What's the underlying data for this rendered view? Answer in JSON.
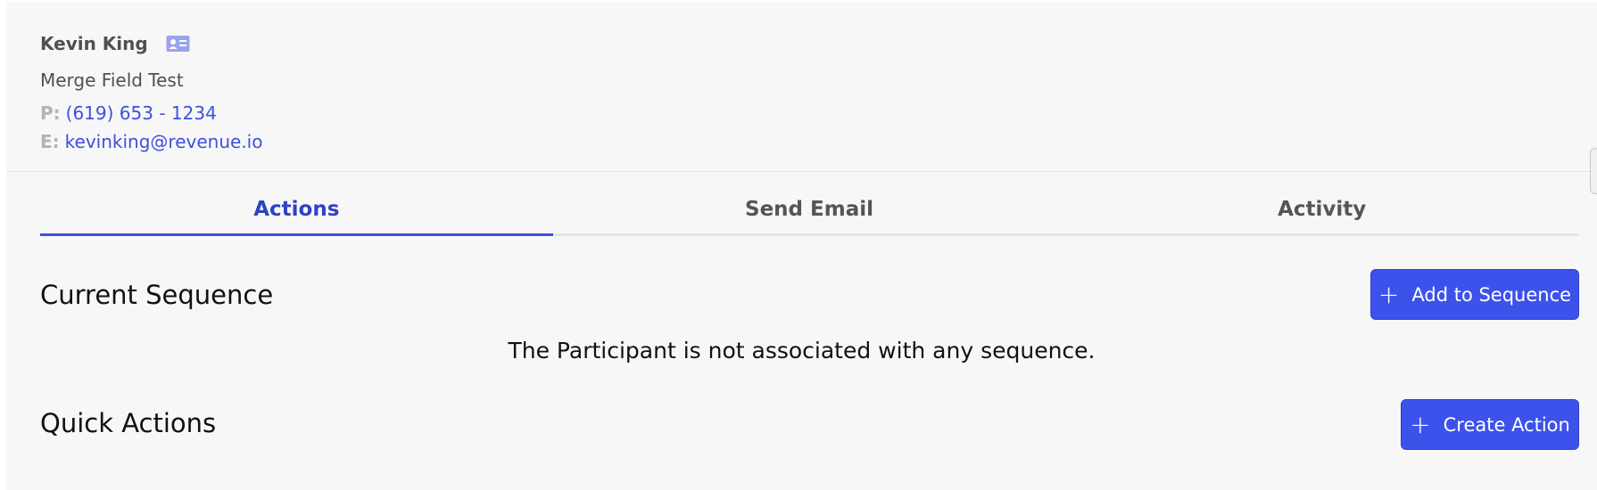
{
  "contact": {
    "name": "Kevin King",
    "company": "Merge Field Test",
    "phone_label": "P:",
    "phone": "(619) 653 - 1234",
    "email_label": "E:",
    "email": "kevinking@revenue.io",
    "card_icon": "contact-card-icon"
  },
  "tabs": [
    {
      "label": "Actions",
      "active": true
    },
    {
      "label": "Send Email",
      "active": false
    },
    {
      "label": "Activity",
      "active": false
    }
  ],
  "current_sequence": {
    "title": "Current Sequence",
    "button_label": "Add to Sequence",
    "empty_message": "The Participant is not associated with any sequence."
  },
  "quick_actions": {
    "title": "Quick Actions",
    "button_label": "Create Action"
  },
  "colors": {
    "accent": "#3d52eb",
    "link": "#3d50dc",
    "active_tab": "#2e42c4",
    "background": "#f7f7f7"
  }
}
